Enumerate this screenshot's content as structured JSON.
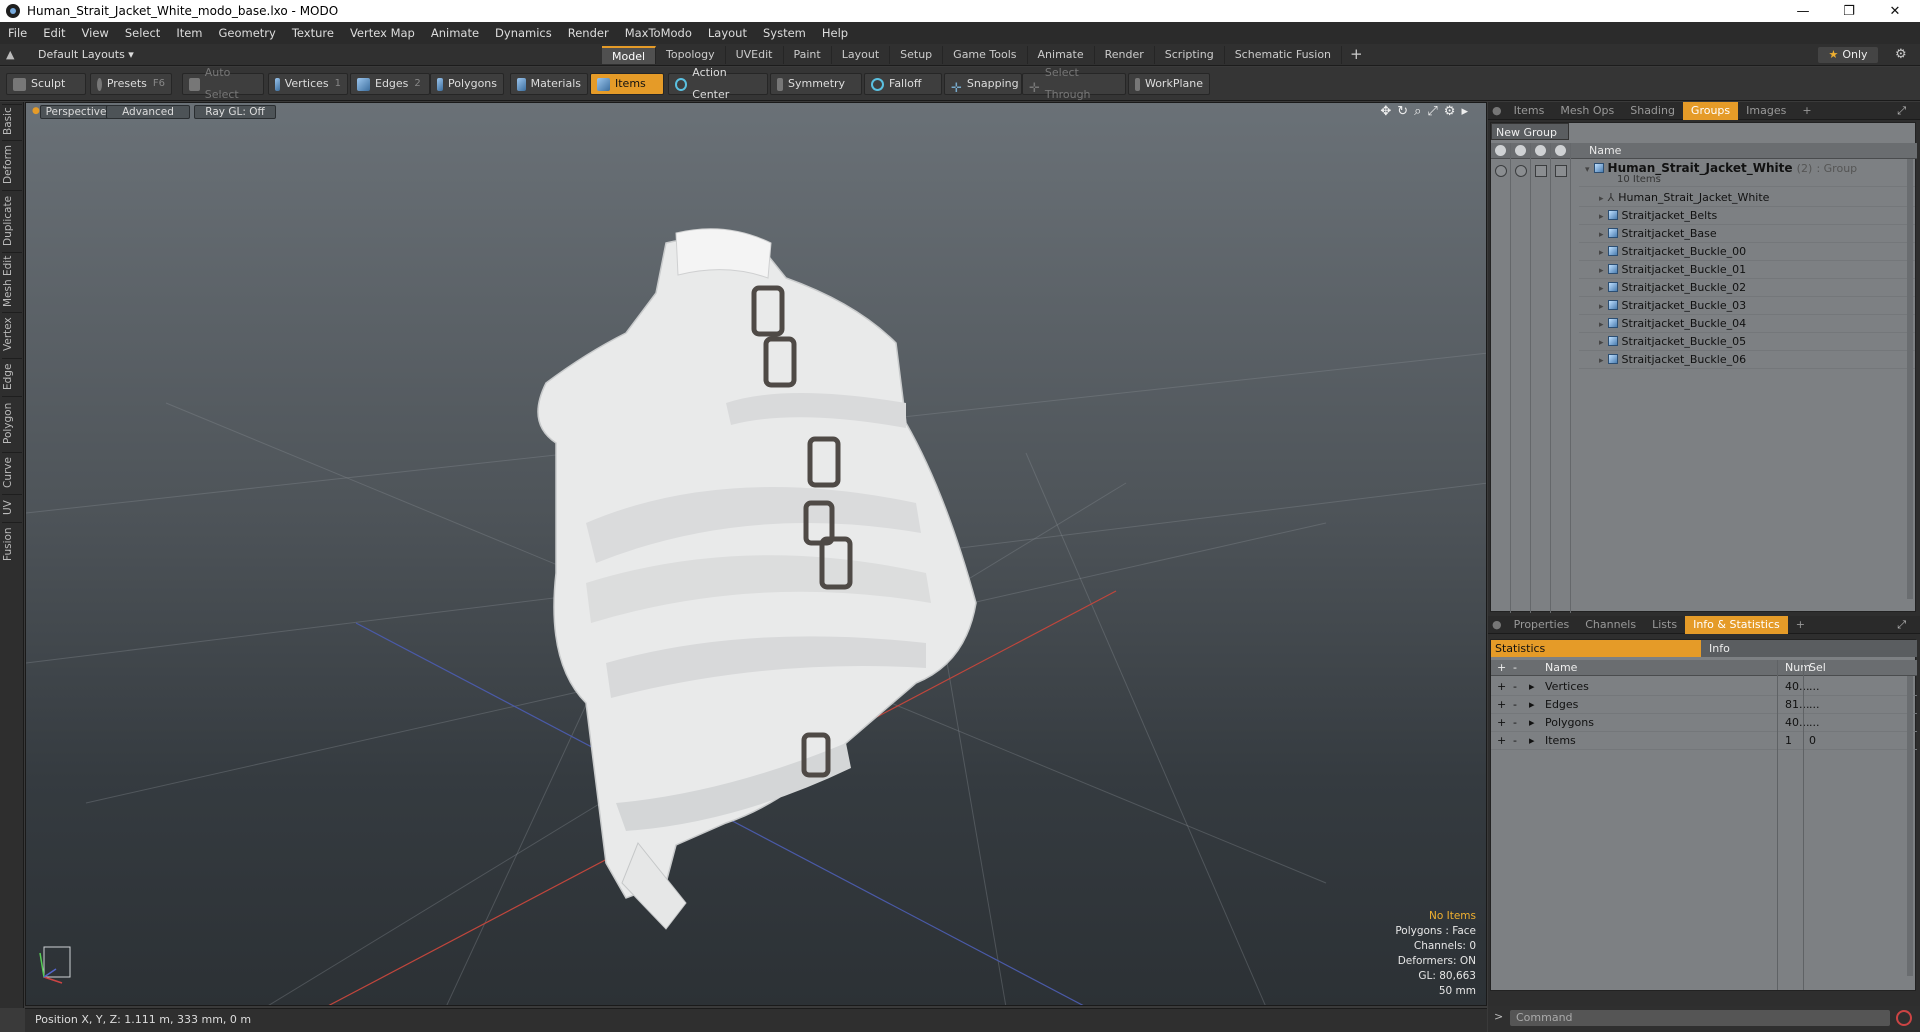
{
  "window": {
    "title": "Human_Strait_Jacket_White_modo_base.lxo - MODO"
  },
  "menu": [
    "File",
    "Edit",
    "View",
    "Select",
    "Item",
    "Geometry",
    "Texture",
    "Vertex Map",
    "Animate",
    "Dynamics",
    "Render",
    "MaxToModo",
    "Layout",
    "System",
    "Help"
  ],
  "layoutbar": {
    "layouts_label": "Default Layouts ▾",
    "tabs": [
      "Model",
      "Topology",
      "UVEdit",
      "Paint",
      "Layout",
      "Setup",
      "Game Tools",
      "Animate",
      "Render",
      "Scripting",
      "Schematic Fusion"
    ],
    "active_tab": "Model",
    "only_label": "Only"
  },
  "toolbar": {
    "sculpt": "Sculpt",
    "presets": "Presets",
    "presets_key": "F6",
    "auto_select": "Auto Select",
    "vertices": "Vertices",
    "vertices_key": "1",
    "edges": "Edges",
    "edges_key": "2",
    "polygons": "Polygons",
    "materials": "Materials",
    "items": "Items",
    "action_center": "Action Center",
    "symmetry": "Symmetry",
    "falloff": "Falloff",
    "snapping": "Snapping",
    "select_through": "Select Through",
    "workplane": "WorkPlane"
  },
  "left_tabs": [
    "Basic",
    "Deform",
    "Duplicate",
    "Mesh Edit",
    "Vertex",
    "Edge",
    "Polygon",
    "Curve",
    "UV",
    "Fusion"
  ],
  "viewport": {
    "view": "Perspective",
    "shading": "Advanced",
    "raygl": "Ray GL: Off",
    "info": {
      "selection": "No Items",
      "polygons": "Polygons : Face",
      "channels": "Channels: 0",
      "deformers": "Deformers: ON",
      "gl": "GL: 80,663",
      "focal": "50 mm"
    }
  },
  "status": {
    "position": "Position X, Y, Z:  1.111 m, 333 mm, 0 m"
  },
  "top_panel": {
    "tabs": [
      "Items",
      "Mesh Ops",
      "Shading",
      "Groups",
      "Images"
    ],
    "active": "Groups",
    "new_group": "New Group",
    "name_col": "Name",
    "root": {
      "name": "Human_Strait_Jacket_White",
      "count": "(2)",
      "type": ": Group",
      "note": "10 Items"
    },
    "items": [
      "Human_Strait_Jacket_White",
      "Straitjacket_Belts",
      "Straitjacket_Base",
      "Straitjacket_Buckle_00",
      "Straitjacket_Buckle_01",
      "Straitjacket_Buckle_02",
      "Straitjacket_Buckle_03",
      "Straitjacket_Buckle_04",
      "Straitjacket_Buckle_05",
      "Straitjacket_Buckle_06"
    ]
  },
  "bottom_panel": {
    "tabs": [
      "Properties",
      "Channels",
      "Lists",
      "Info & Statistics"
    ],
    "active": "Info & Statistics",
    "stat_tab": "Statistics",
    "info_tab": "Info",
    "headers": {
      "name": "Name",
      "num": "Num",
      "sel": "Sel"
    },
    "rows": [
      {
        "name": "Vertices",
        "num": "40...",
        "sel": "..."
      },
      {
        "name": "Edges",
        "num": "81...",
        "sel": "..."
      },
      {
        "name": "Polygons",
        "num": "40...",
        "sel": "..."
      },
      {
        "name": "Items",
        "num": "1",
        "sel": "0"
      }
    ]
  },
  "command": {
    "placeholder": "Command"
  },
  "colors": {
    "accent": "#e59b28",
    "viewport_top": "#6a7177",
    "viewport_bottom": "#2c3135"
  }
}
